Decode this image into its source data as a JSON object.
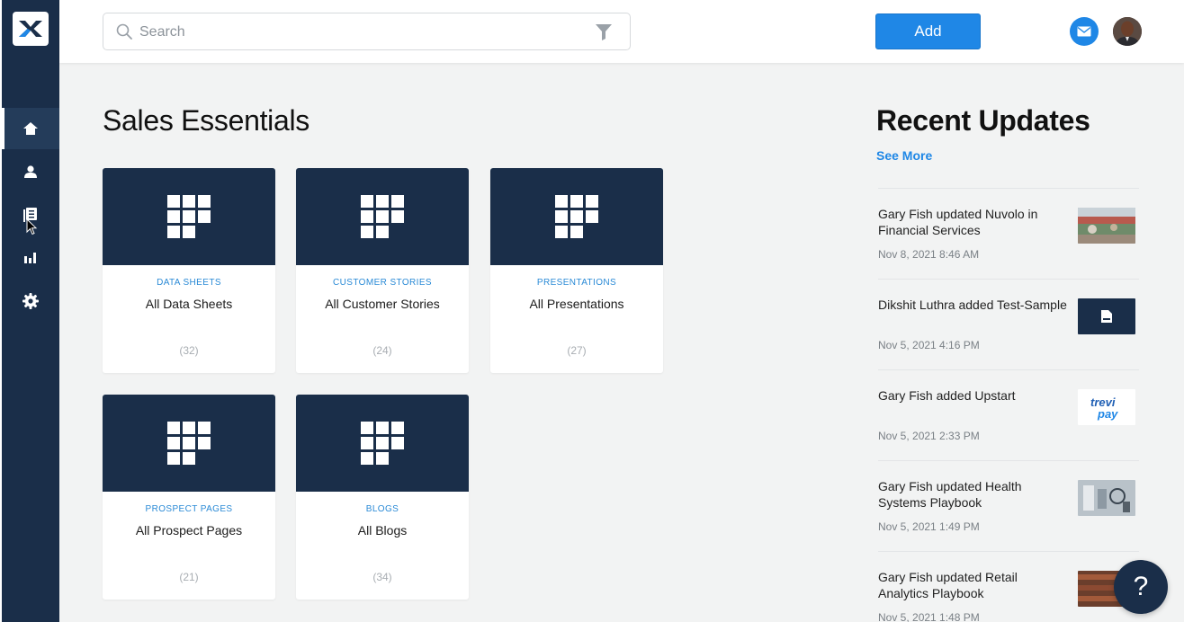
{
  "header": {
    "search_placeholder": "Search",
    "add_label": "Add"
  },
  "main": {
    "title": "Sales Essentials",
    "cards": [
      {
        "category": "DATA SHEETS",
        "name": "All Data Sheets",
        "count": "(32)"
      },
      {
        "category": "CUSTOMER STORIES",
        "name": "All Customer Stories",
        "count": "(24)"
      },
      {
        "category": "PRESENTATIONS",
        "name": "All Presentations",
        "count": "(27)"
      },
      {
        "category": "PROSPECT PAGES",
        "name": "All Prospect Pages",
        "count": "(21)"
      },
      {
        "category": "BLOGS",
        "name": "All Blogs",
        "count": "(34)"
      }
    ]
  },
  "recent": {
    "title": "Recent Updates",
    "see_more": "See More",
    "items": [
      {
        "text": "Gary Fish updated Nuvolo in Financial Services",
        "time": "Nov 8, 2021 8:46 AM",
        "thumb": "photo-thumbnail"
      },
      {
        "text": "Dikshit Luthra added Test-Sample",
        "time": "Nov 5, 2021 4:16 PM",
        "thumb": "file-thumbnail"
      },
      {
        "text": "Gary Fish added Upstart",
        "time": "Nov 5, 2021 2:33 PM",
        "thumb": "trevipay-logo"
      },
      {
        "text": "Gary Fish updated Health Systems Playbook",
        "time": "Nov 5, 2021 1:49 PM",
        "thumb": "photo-thumbnail"
      },
      {
        "text": "Gary Fish updated Retail Analytics Playbook",
        "time": "Nov 5, 2021 1:48 PM",
        "thumb": "photo-thumbnail"
      }
    ],
    "thumb_logo_text_1": "trevi",
    "thumb_logo_text_2": "pay"
  },
  "help": {
    "label": "?"
  },
  "colors": {
    "sidebar": "#1a2e49",
    "accent": "#1f87e6",
    "category": "#2a8ad6",
    "background": "#f2f3f3"
  }
}
